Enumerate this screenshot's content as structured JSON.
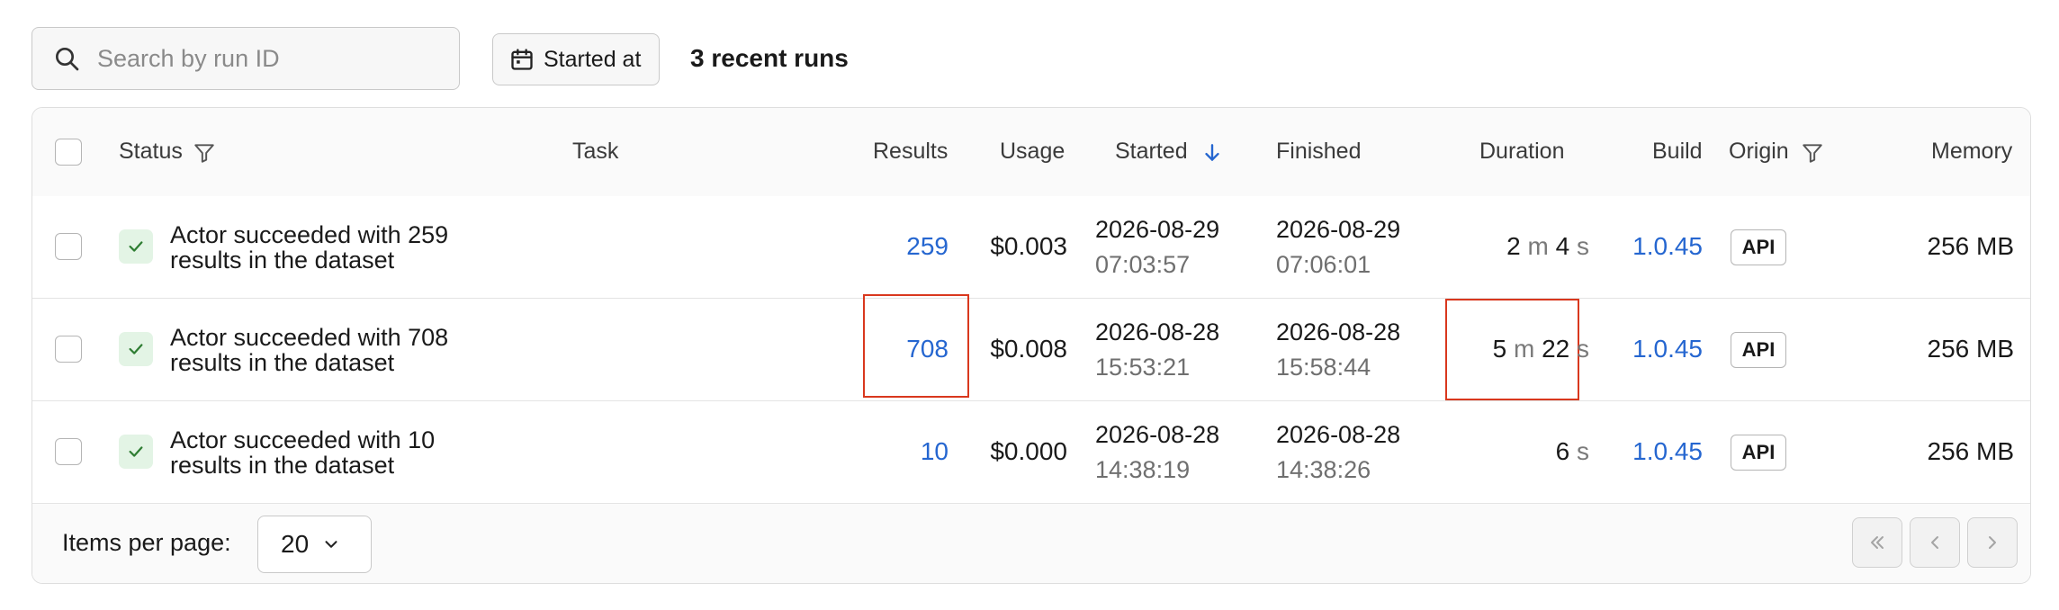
{
  "toolbar": {
    "search_placeholder": "Search by run ID",
    "started_at_label": "Started at",
    "recent_runs_label": "3 recent runs"
  },
  "table": {
    "columns": {
      "status": "Status",
      "task": "Task",
      "results": "Results",
      "usage": "Usage",
      "started": "Started",
      "finished": "Finished",
      "duration": "Duration",
      "build": "Build",
      "origin": "Origin",
      "memory": "Memory"
    },
    "rows": [
      {
        "status": "Actor succeeded with 259 results in the dataset",
        "results": "259",
        "usage": "$0.003",
        "started_date": "2026-08-29",
        "started_time": "07:03:57",
        "finished_date": "2026-08-29",
        "finished_time": "07:06:01",
        "duration_min": "2",
        "duration_min_unit": "m",
        "duration_sec": "4",
        "duration_sec_unit": "s",
        "build": "1.0.45",
        "origin": "API",
        "memory": "256 MB"
      },
      {
        "status": "Actor succeeded with 708 results in the dataset",
        "results": "708",
        "usage": "$0.008",
        "started_date": "2026-08-28",
        "started_time": "15:53:21",
        "finished_date": "2026-08-28",
        "finished_time": "15:58:44",
        "duration_min": "5",
        "duration_min_unit": "m",
        "duration_sec": "22",
        "duration_sec_unit": "s",
        "build": "1.0.45",
        "origin": "API",
        "memory": "256 MB"
      },
      {
        "status": "Actor succeeded with 10 results in the dataset",
        "results": "10",
        "usage": "$0.000",
        "started_date": "2026-08-28",
        "started_time": "14:38:19",
        "finished_date": "2026-08-28",
        "finished_time": "14:38:26",
        "duration_sec": "6",
        "duration_sec_unit": "s",
        "build": "1.0.45",
        "origin": "API",
        "memory": "256 MB"
      }
    ]
  },
  "footer": {
    "items_per_page_label": "Items per page:",
    "items_per_page_value": "20"
  },
  "colors": {
    "link": "#2566d0",
    "highlight": "#d9381e",
    "success_bg": "#e3f4e5",
    "success_check": "#2e7d32"
  }
}
